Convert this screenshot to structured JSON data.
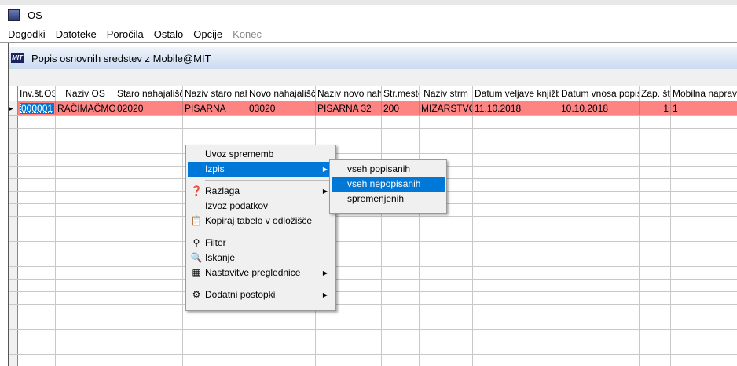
{
  "window": {
    "title": "OS"
  },
  "menubar": [
    "Dogodki",
    "Datoteke",
    "Poročila",
    "Ostalo",
    "Opcije",
    "Konec"
  ],
  "child": {
    "title": "Popis osnovnih sredstev z Mobile@MIT",
    "logo": "MIT"
  },
  "table": {
    "columns": [
      "Inv.št.OS",
      "Naziv OS",
      "Staro nahajališče",
      "Naziv staro nah.",
      "Novo nahajališče",
      "Naziv novo nah.",
      "Str.mesto",
      "Naziv strm",
      "Datum veljave knjižbe",
      "Datum vnosa popisa",
      "Zap. št.",
      "Mobilna naprava"
    ],
    "rows": [
      [
        "000001",
        "RAČIMAČMOL",
        "02020",
        "PISARNA",
        "03020",
        "PISARNA 32",
        "200",
        "MIZARSTVO",
        "11.10.2018",
        "10.10.2018",
        "1",
        "1"
      ]
    ],
    "row_color": "#fe8484"
  },
  "context_menu": {
    "items": [
      {
        "label": "Uvoz sprememb"
      },
      {
        "label": "Izpis",
        "submenu": true,
        "highlighted": true
      },
      {
        "label": "Razlaga",
        "icon": "help-book-icon",
        "submenu": true
      },
      {
        "label": "Izvoz podatkov"
      },
      {
        "label": "Kopiraj tabelo v odložišče",
        "icon": "copy-icon"
      },
      {
        "label": "Filter",
        "icon": "filter-icon"
      },
      {
        "label": "Iskanje",
        "icon": "magnifier-icon"
      },
      {
        "label": "Nastavitve preglednice",
        "icon": "grid-settings-icon",
        "submenu": true
      },
      {
        "label": "Dodatni postopki",
        "icon": "gears-icon",
        "submenu": true
      }
    ]
  },
  "submenu": {
    "items": [
      "vseh popisanih",
      "vseh nepopisanih",
      "spremenjenih"
    ],
    "highlighted": "vseh nepopisanih"
  }
}
